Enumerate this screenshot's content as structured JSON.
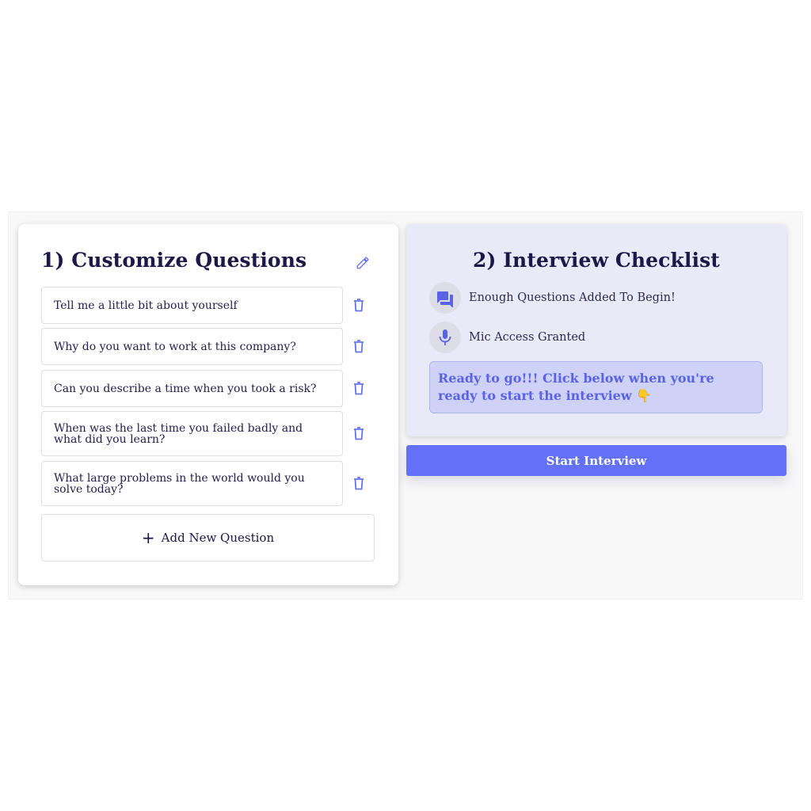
{
  "left_card": {
    "title": "1) Customize Questions",
    "questions": [
      "Tell me a little bit about yourself",
      "Why do you want to work at this  company?",
      "Can you describe a time when you took a risk?",
      "When was the last time you failed badly and what did you learn?",
      "What large problems in the world would you solve today?"
    ],
    "add_label": "Add New Question",
    "add_symbol": "+"
  },
  "right_card": {
    "title": "2) Interview Checklist",
    "checklist": [
      {
        "icon": "chat-icon",
        "label": "Enough Questions Added To Begin!"
      },
      {
        "icon": "microphone-icon",
        "label": "Mic Access Granted"
      }
    ],
    "ready_message": "Ready to go!!! Click below when you're ready to start the interview 👇",
    "start_label": "Start Interview"
  },
  "colors": {
    "accent": "#6271f8",
    "icon": "#6673f0",
    "title": "#1c1848",
    "ready_bg": "#cfd2f7",
    "ready_text": "#5a62e8"
  }
}
